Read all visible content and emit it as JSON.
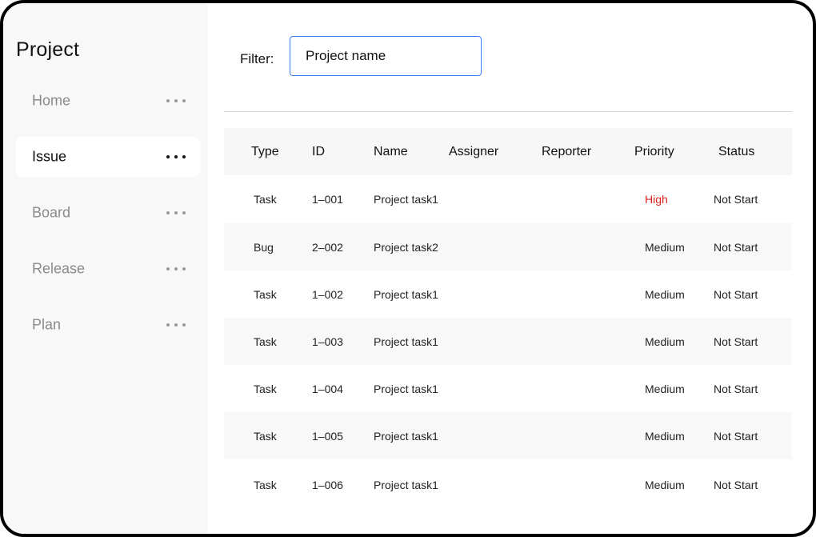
{
  "sidebar": {
    "title": "Project",
    "items": [
      {
        "label": "Home"
      },
      {
        "label": "Issue"
      },
      {
        "label": "Board"
      },
      {
        "label": "Release"
      },
      {
        "label": "Plan"
      }
    ],
    "active_item": "Issue"
  },
  "filter": {
    "label": "Filter:",
    "value": "Project name"
  },
  "table": {
    "columns": [
      "Type",
      "ID",
      "Name",
      "Assigner",
      "Reporter",
      "Priority",
      "Status"
    ],
    "rows": [
      {
        "type": "Task",
        "id": "1–001",
        "name": "Project task1",
        "assigner": "",
        "reporter": "",
        "priority": "High",
        "status": "Not Start"
      },
      {
        "type": "Bug",
        "id": "2–002",
        "name": "Project task2",
        "assigner": "",
        "reporter": "",
        "priority": "Medium",
        "status": "Not Start"
      },
      {
        "type": "Task",
        "id": "1–002",
        "name": "Project task1",
        "assigner": "",
        "reporter": "",
        "priority": "Medium",
        "status": "Not Start"
      },
      {
        "type": "Task",
        "id": "1–003",
        "name": "Project task1",
        "assigner": "",
        "reporter": "",
        "priority": "Medium",
        "status": "Not Start"
      },
      {
        "type": "Task",
        "id": "1–004",
        "name": "Project task1",
        "assigner": "",
        "reporter": "",
        "priority": "Medium",
        "status": "Not Start"
      },
      {
        "type": "Task",
        "id": "1–005",
        "name": "Project task1",
        "assigner": "",
        "reporter": "",
        "priority": "Medium",
        "status": "Not Start"
      },
      {
        "type": "Task",
        "id": "1–006",
        "name": "Project task1",
        "assigner": "",
        "reporter": "",
        "priority": "Medium",
        "status": "Not Start"
      }
    ]
  },
  "colors": {
    "accent": "#3b7bf0",
    "priority_high": "#e02020",
    "sidebar_bg": "#f8f8f8"
  }
}
